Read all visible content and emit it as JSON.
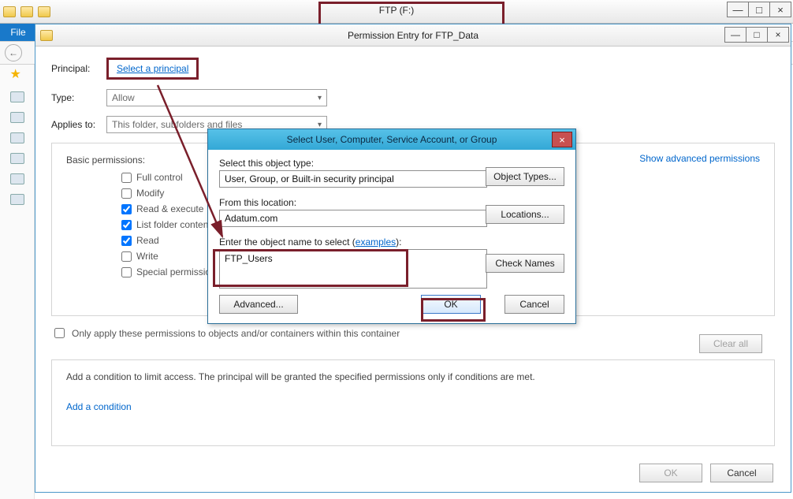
{
  "bg": {
    "title": "FTP (F:)",
    "file_tab": "File",
    "winctrl": {
      "min": "—",
      "max": "□",
      "close": "×"
    }
  },
  "perm": {
    "title": "Permission Entry for FTP_Data",
    "principal_label": "Principal:",
    "select_principal": "Select a principal",
    "type_label": "Type:",
    "type_value": "Allow",
    "applies_label": "Applies to:",
    "applies_value": "This folder, subfolders and files",
    "basic_label": "Basic permissions:",
    "checks": {
      "full": "Full control",
      "modify": "Modify",
      "readexec": "Read & execute",
      "listfolder": "List folder contents",
      "read": "Read",
      "write": "Write",
      "special": "Special permissions"
    },
    "show_adv": "Show advanced permissions",
    "only_apply": "Only apply these permissions to objects and/or containers within this container",
    "clear_all": "Clear all",
    "cond_text": "Add a condition to limit access. The principal will be granted the specified permissions only if conditions are met.",
    "add_cond": "Add a condition",
    "ok": "OK",
    "cancel": "Cancel",
    "winctrl": {
      "min": "—",
      "max": "□",
      "close": "×"
    }
  },
  "sel": {
    "title": "Select User, Computer, Service Account, or Group",
    "otype_label": "Select this object type:",
    "otype_value": "User, Group, or Built-in security principal",
    "loc_label": "From this location:",
    "loc_value": "Adatum.com",
    "objname_label_pre": "Enter the object name to select (",
    "examples": "examples",
    "objname_label_post": "):",
    "objname_value": "FTP_Users",
    "btn_types": "Object Types...",
    "btn_locations": "Locations...",
    "btn_check": "Check Names",
    "btn_advanced": "Advanced...",
    "btn_ok": "OK",
    "btn_cancel": "Cancel",
    "close": "×"
  }
}
